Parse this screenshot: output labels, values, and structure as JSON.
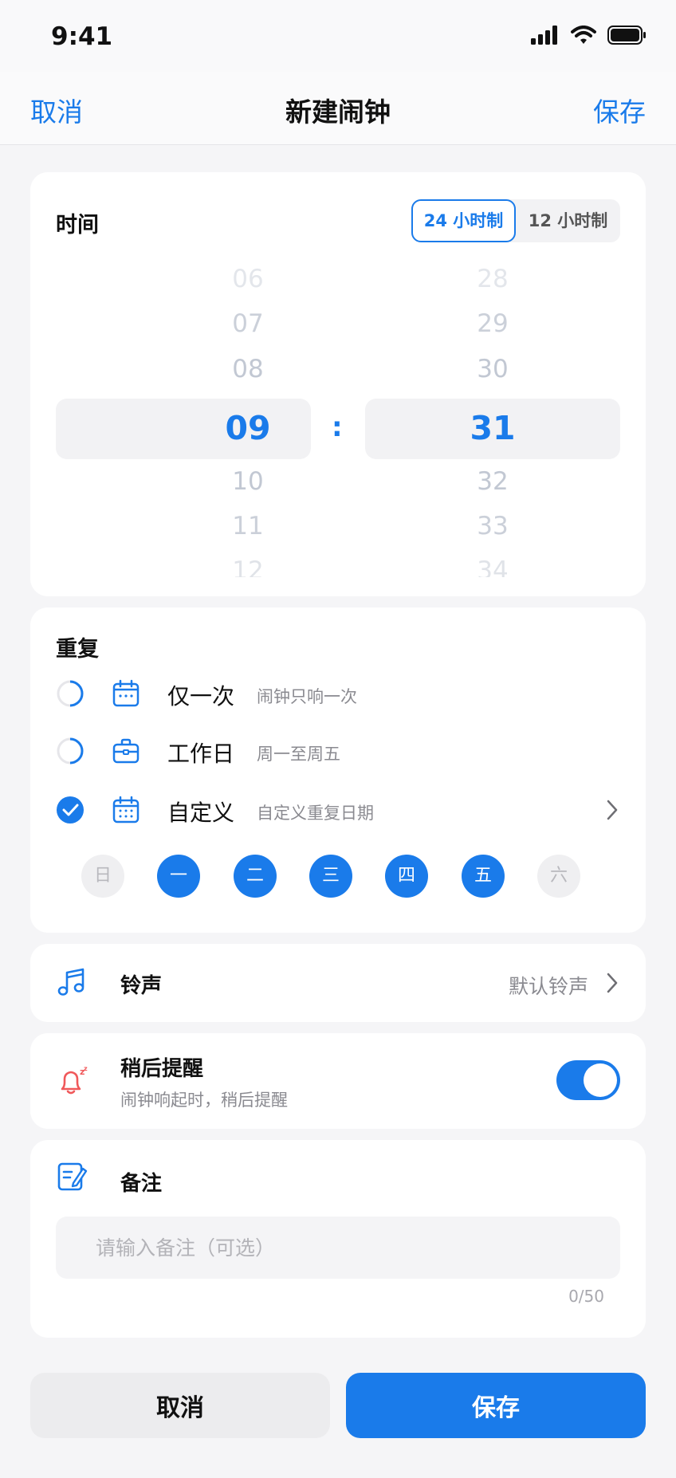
{
  "status_bar": {
    "time": "9:41"
  },
  "nav": {
    "cancel": "取消",
    "title": "新建闹钟",
    "save": "保存"
  },
  "time_section": {
    "title": "时间",
    "format_options": [
      "24 小时制",
      "12 小时制"
    ],
    "selected_format": "24 小时制",
    "hours": [
      "06",
      "07",
      "08",
      "09",
      "10",
      "11",
      "12"
    ],
    "selected_hour": "09",
    "separator": ":",
    "minutes": [
      "28",
      "29",
      "30",
      "31",
      "32",
      "33",
      "34"
    ],
    "selected_minute": "31"
  },
  "repeat_section": {
    "title": "重复",
    "options": [
      {
        "label": "仅一次",
        "sub": "闹钟只响一次",
        "checked": false,
        "icon": "calendar-icon"
      },
      {
        "label": "工作日",
        "sub": "周一至周五",
        "checked": false,
        "icon": "briefcase-icon"
      },
      {
        "label": "自定义",
        "sub": "自定义重复日期",
        "checked": true,
        "icon": "calendar-grid-icon"
      }
    ],
    "days": [
      {
        "label": "日",
        "on": false
      },
      {
        "label": "一",
        "on": true
      },
      {
        "label": "二",
        "on": true
      },
      {
        "label": "三",
        "on": true
      },
      {
        "label": "四",
        "on": true
      },
      {
        "label": "五",
        "on": true
      },
      {
        "label": "六",
        "on": false
      }
    ]
  },
  "ringtone": {
    "label": "铃声",
    "value": "默认铃声",
    "icon": "music-note-icon"
  },
  "snooze": {
    "label": "稍后提醒",
    "sub": "闹钟响起时，稍后提醒",
    "enabled": true,
    "icon": "bell-snooze-icon"
  },
  "note": {
    "label": "备注",
    "placeholder": "请输入备注（可选）",
    "value": "",
    "counter": "0/50",
    "icon": "edit-note-icon"
  },
  "footer": {
    "cancel": "取消",
    "save": "保存"
  },
  "colors": {
    "accent": "#1a7bea",
    "alert": "#f0585a"
  }
}
